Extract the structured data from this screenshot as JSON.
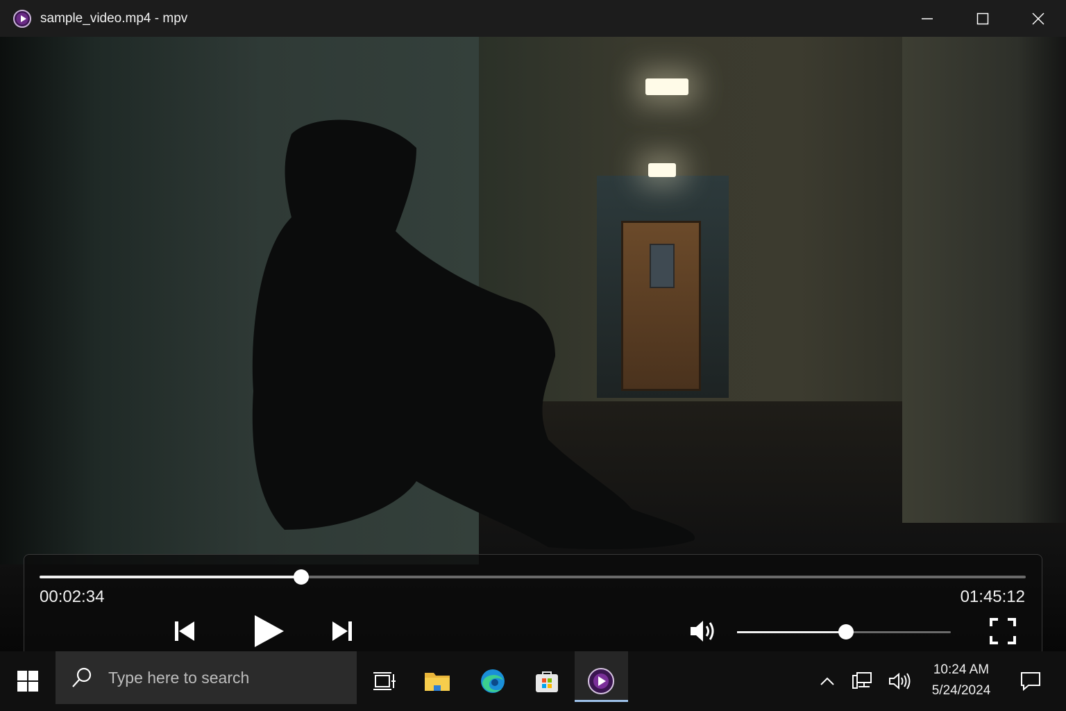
{
  "window": {
    "title": "sample_video.mp4 - mpv",
    "app_icon": "mpv-icon",
    "controls": [
      "minimize-icon",
      "maximize-icon",
      "close-icon"
    ]
  },
  "player": {
    "current_time": "00:02:34",
    "duration": "01:45:12",
    "seek_progress": 0.265,
    "volume_level": 0.51,
    "buttons": {
      "previous": "skip-previous-icon",
      "play": "play-icon",
      "next": "skip-next-icon",
      "volume": "volume-icon",
      "fullscreen": "fullscreen-icon"
    }
  },
  "taskbar": {
    "start": "windows-start-icon",
    "search_placeholder": "Type here to search",
    "apps": [
      "task-view-icon",
      "file-explorer-icon",
      "edge-icon",
      "store-icon",
      "mpv-icon"
    ],
    "tray": [
      "chevron-up-icon",
      "network-icon",
      "volume-icon"
    ],
    "time": "10:24 AM",
    "date": "5/24/2024",
    "notifications": "notification-icon"
  },
  "colors": {
    "titlebar": "#1c1c1c",
    "taskbar": "#101010",
    "accent": "#9ec2ea",
    "mpv_purple": "#6a2a86"
  }
}
